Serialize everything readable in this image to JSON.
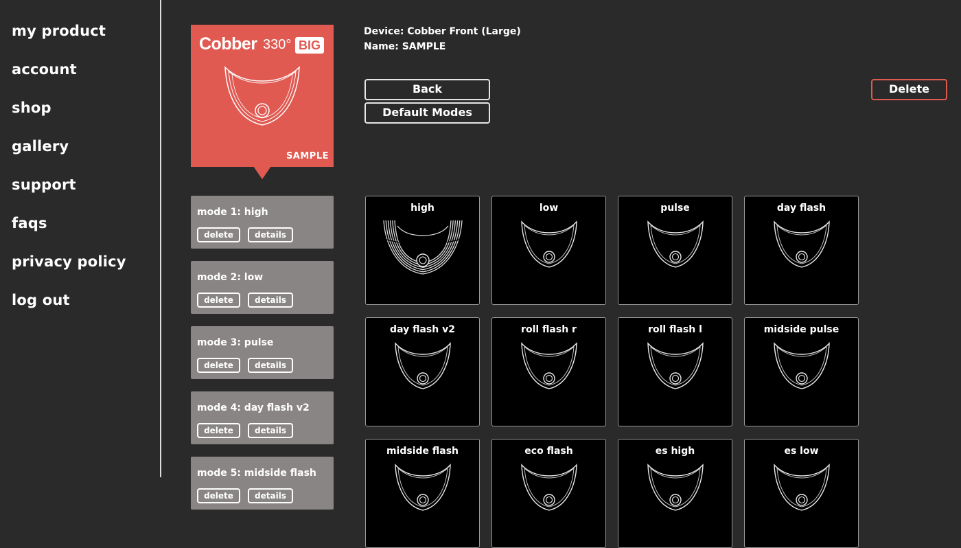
{
  "nav": [
    "my product",
    "account",
    "shop",
    "gallery",
    "support",
    "faqs",
    "privacy policy",
    "log out"
  ],
  "card": {
    "brand": "Cobber",
    "model": "330°",
    "badge": "BIG",
    "sample_label": "SAMPLE",
    "color": "#e05a52"
  },
  "device": {
    "device_line": "Device: Cobber Front (Large)",
    "name_line": "Name: SAMPLE"
  },
  "buttons": {
    "back": "Back",
    "default_modes": "Default Modes",
    "delete": "Delete"
  },
  "modes": [
    {
      "title": "mode 1: high",
      "delete": "delete",
      "details": "details"
    },
    {
      "title": "mode 2: low",
      "delete": "delete",
      "details": "details"
    },
    {
      "title": "mode 3: pulse",
      "delete": "delete",
      "details": "details"
    },
    {
      "title": "mode 4: day flash v2",
      "delete": "delete",
      "details": "details"
    },
    {
      "title": "mode 5: midside flash",
      "delete": "delete",
      "details": "details"
    }
  ],
  "tiles": [
    "high",
    "low",
    "pulse",
    "day flash",
    "day flash v2",
    "roll flash r",
    "roll flash l",
    "midside pulse",
    "midside flash",
    "eco flash",
    "es high",
    "es low"
  ],
  "colors": {
    "background": "#2a2a2a",
    "accent": "#e05a52",
    "mode_item": "#8a8585"
  }
}
